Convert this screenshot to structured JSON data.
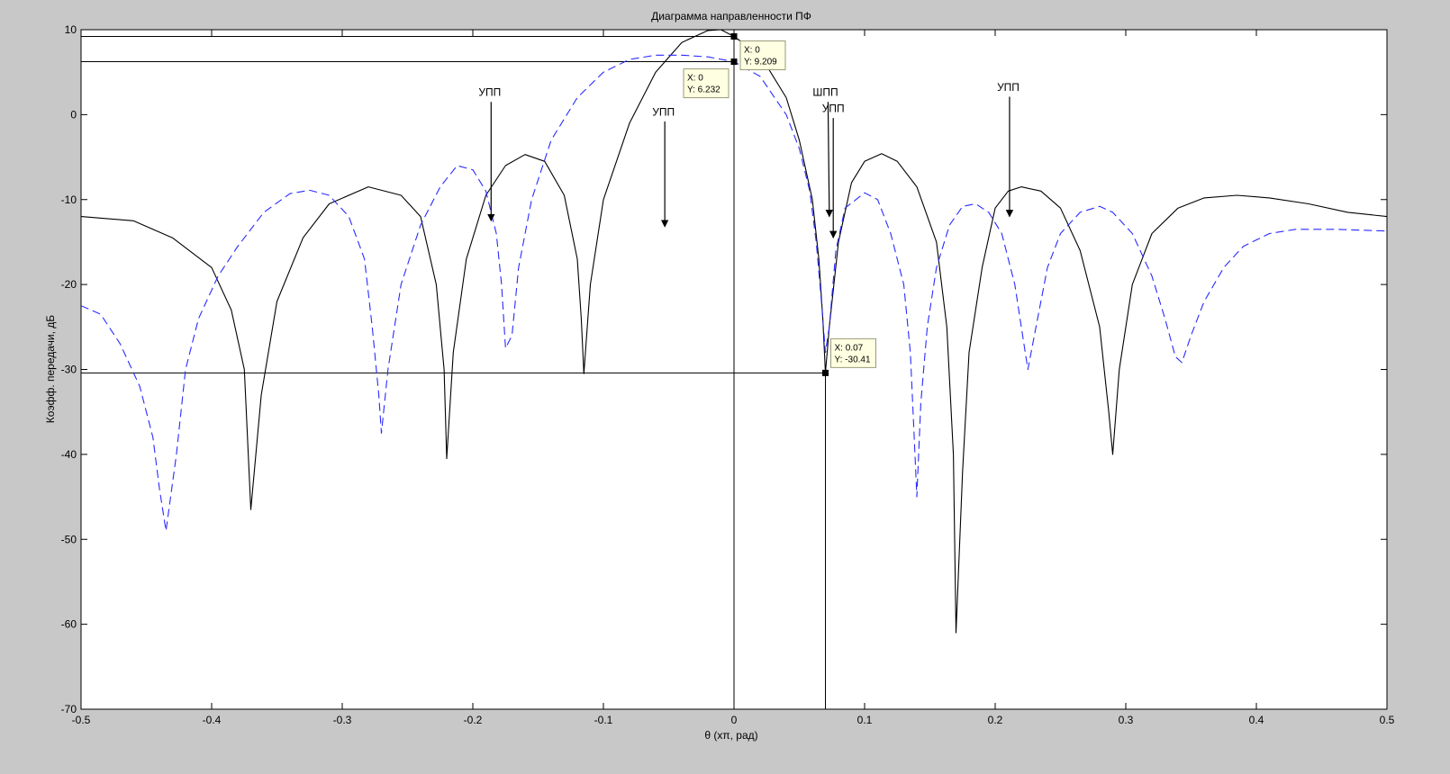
{
  "chart_data": {
    "type": "line",
    "title": "Диаграмма направленности ПФ",
    "xlabel": "θ (хπ, рад)",
    "ylabel": "Коэфф. передачи, дБ",
    "xlim": [
      -0.5,
      0.5
    ],
    "ylim": [
      -70,
      10
    ],
    "xticks": [
      -0.5,
      -0.4,
      -0.3,
      -0.2,
      -0.1,
      0,
      0.1,
      0.2,
      0.3,
      0.4,
      0.5
    ],
    "xtick_labels": [
      "-0.5",
      "-0.4",
      "-0.3",
      "-0.2",
      "-0.1",
      "0",
      "0.1",
      "0.2",
      "0.3",
      "0.4",
      "0.5"
    ],
    "yticks": [
      10,
      0,
      -10,
      -20,
      -30,
      -40,
      -50,
      -60,
      -70
    ],
    "ytick_labels": [
      "10",
      "0",
      "-10",
      "-20",
      "-30",
      "-40",
      "-50",
      "-60",
      "-70"
    ],
    "grid": false,
    "series": [
      {
        "color": "#000000",
        "style": "solid",
        "points": [
          [
            -0.5,
            -12
          ],
          [
            -0.46,
            -12.5
          ],
          [
            -0.43,
            -14.5
          ],
          [
            -0.4,
            -18
          ],
          [
            -0.385,
            -23
          ],
          [
            -0.375,
            -30
          ],
          [
            -0.37,
            -46.5
          ],
          [
            -0.362,
            -33
          ],
          [
            -0.35,
            -22
          ],
          [
            -0.33,
            -14.5
          ],
          [
            -0.31,
            -10.5
          ],
          [
            -0.28,
            -8.5
          ],
          [
            -0.255,
            -9.5
          ],
          [
            -0.24,
            -12
          ],
          [
            -0.228,
            -20
          ],
          [
            -0.222,
            -30
          ],
          [
            -0.22,
            -40.5
          ],
          [
            -0.215,
            -28
          ],
          [
            -0.205,
            -17
          ],
          [
            -0.19,
            -9.5
          ],
          [
            -0.175,
            -6
          ],
          [
            -0.16,
            -4.7
          ],
          [
            -0.145,
            -5.5
          ],
          [
            -0.13,
            -9.5
          ],
          [
            -0.12,
            -17
          ],
          [
            -0.117,
            -24
          ],
          [
            -0.115,
            -30.5
          ],
          [
            -0.11,
            -20
          ],
          [
            -0.1,
            -10
          ],
          [
            -0.08,
            -1
          ],
          [
            -0.06,
            5
          ],
          [
            -0.04,
            8.5
          ],
          [
            -0.02,
            9.9
          ],
          [
            -0.01,
            10
          ],
          [
            0,
            9.209
          ],
          [
            0.02,
            7
          ],
          [
            0.04,
            2
          ],
          [
            0.05,
            -3
          ],
          [
            0.06,
            -10
          ],
          [
            0.065,
            -17
          ],
          [
            0.068,
            -24
          ],
          [
            0.07,
            -30.41
          ],
          [
            0.073,
            -25
          ],
          [
            0.08,
            -15
          ],
          [
            0.09,
            -8
          ],
          [
            0.1,
            -5.5
          ],
          [
            0.113,
            -4.6
          ],
          [
            0.125,
            -5.5
          ],
          [
            0.14,
            -8.5
          ],
          [
            0.155,
            -15
          ],
          [
            0.163,
            -25
          ],
          [
            0.168,
            -40
          ],
          [
            0.17,
            -61
          ],
          [
            0.175,
            -42
          ],
          [
            0.18,
            -28
          ],
          [
            0.19,
            -18
          ],
          [
            0.2,
            -11
          ],
          [
            0.21,
            -9
          ],
          [
            0.22,
            -8.5
          ],
          [
            0.235,
            -9
          ],
          [
            0.25,
            -11
          ],
          [
            0.265,
            -16
          ],
          [
            0.28,
            -25
          ],
          [
            0.287,
            -35
          ],
          [
            0.29,
            -40
          ],
          [
            0.295,
            -30
          ],
          [
            0.305,
            -20
          ],
          [
            0.32,
            -14
          ],
          [
            0.34,
            -11
          ],
          [
            0.36,
            -9.8
          ],
          [
            0.385,
            -9.5
          ],
          [
            0.41,
            -9.8
          ],
          [
            0.44,
            -10.5
          ],
          [
            0.47,
            -11.5
          ],
          [
            0.5,
            -12
          ]
        ]
      },
      {
        "color": "#2a2aff",
        "style": "dashed",
        "points": [
          [
            -0.5,
            -22.5
          ],
          [
            -0.485,
            -23.5
          ],
          [
            -0.47,
            -27
          ],
          [
            -0.455,
            -32
          ],
          [
            -0.445,
            -38
          ],
          [
            -0.44,
            -44
          ],
          [
            -0.435,
            -49
          ],
          [
            -0.427,
            -40
          ],
          [
            -0.42,
            -30
          ],
          [
            -0.41,
            -24
          ],
          [
            -0.395,
            -19
          ],
          [
            -0.38,
            -15.5
          ],
          [
            -0.36,
            -11.5
          ],
          [
            -0.34,
            -9.3
          ],
          [
            -0.325,
            -8.9
          ],
          [
            -0.31,
            -9.5
          ],
          [
            -0.295,
            -12
          ],
          [
            -0.283,
            -17
          ],
          [
            -0.277,
            -25
          ],
          [
            -0.272,
            -33
          ],
          [
            -0.27,
            -37.5
          ],
          [
            -0.265,
            -30
          ],
          [
            -0.255,
            -20
          ],
          [
            -0.24,
            -13
          ],
          [
            -0.225,
            -8.5
          ],
          [
            -0.212,
            -6
          ],
          [
            -0.2,
            -6.5
          ],
          [
            -0.19,
            -9
          ],
          [
            -0.182,
            -14
          ],
          [
            -0.178,
            -20
          ],
          [
            -0.175,
            -27.5
          ],
          [
            -0.17,
            -26
          ],
          [
            -0.165,
            -18
          ],
          [
            -0.155,
            -10
          ],
          [
            -0.14,
            -3
          ],
          [
            -0.12,
            2
          ],
          [
            -0.1,
            5
          ],
          [
            -0.08,
            6.5
          ],
          [
            -0.06,
            7
          ],
          [
            -0.04,
            7
          ],
          [
            -0.02,
            6.8
          ],
          [
            0,
            6.232
          ],
          [
            0.02,
            4.5
          ],
          [
            0.04,
            0
          ],
          [
            0.05,
            -4
          ],
          [
            0.058,
            -9
          ],
          [
            0.063,
            -15
          ],
          [
            0.067,
            -22
          ],
          [
            0.07,
            -28
          ],
          [
            0.073,
            -25
          ],
          [
            0.078,
            -16
          ],
          [
            0.085,
            -11
          ],
          [
            0.1,
            -9.2
          ],
          [
            0.11,
            -10
          ],
          [
            0.12,
            -14
          ],
          [
            0.13,
            -20
          ],
          [
            0.135,
            -28
          ],
          [
            0.138,
            -38
          ],
          [
            0.14,
            -45
          ],
          [
            0.143,
            -34
          ],
          [
            0.148,
            -25
          ],
          [
            0.155,
            -18
          ],
          [
            0.165,
            -13
          ],
          [
            0.175,
            -10.8
          ],
          [
            0.185,
            -10.5
          ],
          [
            0.195,
            -11.5
          ],
          [
            0.205,
            -14
          ],
          [
            0.215,
            -20
          ],
          [
            0.22,
            -25
          ],
          [
            0.225,
            -30
          ],
          [
            0.23,
            -26
          ],
          [
            0.24,
            -18
          ],
          [
            0.25,
            -14
          ],
          [
            0.265,
            -11.5
          ],
          [
            0.28,
            -10.8
          ],
          [
            0.29,
            -11.5
          ],
          [
            0.305,
            -14
          ],
          [
            0.32,
            -19
          ],
          [
            0.33,
            -24
          ],
          [
            0.338,
            -28.5
          ],
          [
            0.343,
            -29.2
          ],
          [
            0.35,
            -26
          ],
          [
            0.36,
            -22
          ],
          [
            0.375,
            -18
          ],
          [
            0.39,
            -15.5
          ],
          [
            0.41,
            -14
          ],
          [
            0.43,
            -13.5
          ],
          [
            0.46,
            -13.5
          ],
          [
            0.5,
            -13.7
          ]
        ]
      }
    ],
    "reference_lines": [
      {
        "type": "h",
        "y": 9.209,
        "x_from": -0.5,
        "x_to": 0
      },
      {
        "type": "h",
        "y": 6.232,
        "x_from": -0.5,
        "x_to": 0
      },
      {
        "type": "h",
        "y": -30.41,
        "x_from": -0.5,
        "x_to": 0.07
      },
      {
        "type": "v",
        "x": 0,
        "y_from": -70,
        "y_to": 9.209
      },
      {
        "type": "v",
        "x": 0.07,
        "y_from": -70,
        "y_to": -30.41
      }
    ],
    "datatips": [
      {
        "x": 0,
        "y": 9.209,
        "line1": "X: 0",
        "line2": "Y: 9.209",
        "placement": "right"
      },
      {
        "x": 0,
        "y": 6.232,
        "line1": "X: 0",
        "line2": "Y: 6.232",
        "placement": "below-left"
      },
      {
        "x": 0.07,
        "y": -30.41,
        "line1": "X: 0.07",
        "line2": "Y: -30.41",
        "placement": "above-right"
      }
    ],
    "annotations": [
      {
        "text": "УПП",
        "text_x": -0.187,
        "text_y": 2.2,
        "arrow_from": [
          -0.186,
          1.5
        ],
        "arrow_to": [
          -0.186,
          -12.5
        ]
      },
      {
        "text": "УПП",
        "text_x": -0.054,
        "text_y": -0.1,
        "arrow_from": [
          -0.053,
          -0.8
        ],
        "arrow_to": [
          -0.053,
          -13.2
        ]
      },
      {
        "text": "ШПП",
        "text_x": 0.07,
        "text_y": 2.2,
        "arrow_from": [
          0.072,
          1.5
        ],
        "arrow_to": [
          0.073,
          -12
        ]
      },
      {
        "text": "УПП",
        "text_x": 0.076,
        "text_y": 0.3,
        "arrow_from": [
          0.076,
          -0.4
        ],
        "arrow_to": [
          0.076,
          -14.5
        ]
      },
      {
        "text": "УПП",
        "text_x": 0.21,
        "text_y": 2.8,
        "arrow_from": [
          0.211,
          2.1
        ],
        "arrow_to": [
          0.211,
          -12
        ]
      }
    ]
  }
}
